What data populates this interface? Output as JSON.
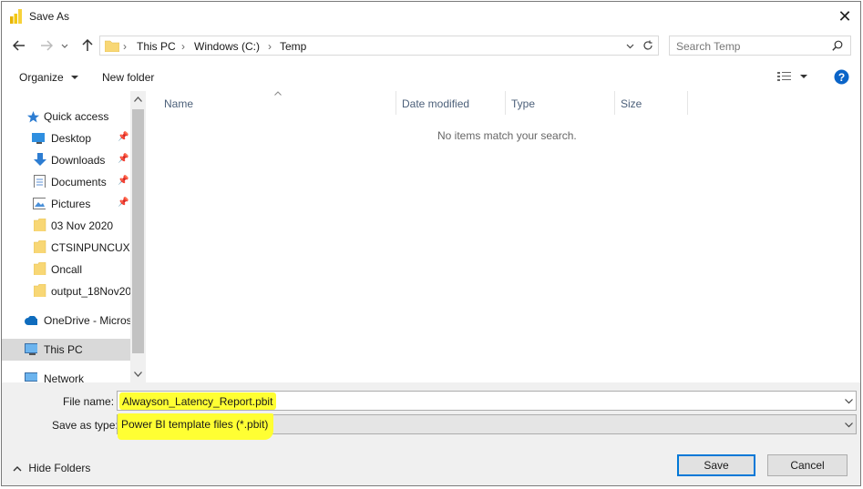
{
  "window": {
    "title": "Save As"
  },
  "address": {
    "crumbs": [
      "This PC",
      "Windows (C:)",
      "Temp"
    ]
  },
  "search": {
    "placeholder": "Search Temp"
  },
  "toolbar": {
    "organize": "Organize",
    "new_folder": "New folder"
  },
  "sidebar": {
    "items": [
      {
        "label": "Quick access"
      },
      {
        "label": "Desktop"
      },
      {
        "label": "Downloads"
      },
      {
        "label": "Documents"
      },
      {
        "label": "Pictures"
      },
      {
        "label": "03 Nov 2020"
      },
      {
        "label": "CTSINPUNCUXP"
      },
      {
        "label": "Oncall"
      },
      {
        "label": "output_18Nov20"
      },
      {
        "label": "OneDrive - Micros"
      },
      {
        "label": "This PC"
      },
      {
        "label": "Network"
      }
    ]
  },
  "columns": [
    "Name",
    "Date modified",
    "Type",
    "Size"
  ],
  "content": {
    "empty_message": "No items match your search."
  },
  "form": {
    "file_name_label": "File name:",
    "file_name_value": "Alwayson_Latency_Report.pbit",
    "save_type_label": "Save as type:",
    "save_type_value": "Power BI template files (*.pbit)"
  },
  "footer": {
    "hide_folders": "Hide Folders",
    "save": "Save",
    "cancel": "Cancel"
  },
  "colors": {
    "accent": "#0078d7",
    "highlight": "#ffff33",
    "folder": "#f8d775"
  }
}
